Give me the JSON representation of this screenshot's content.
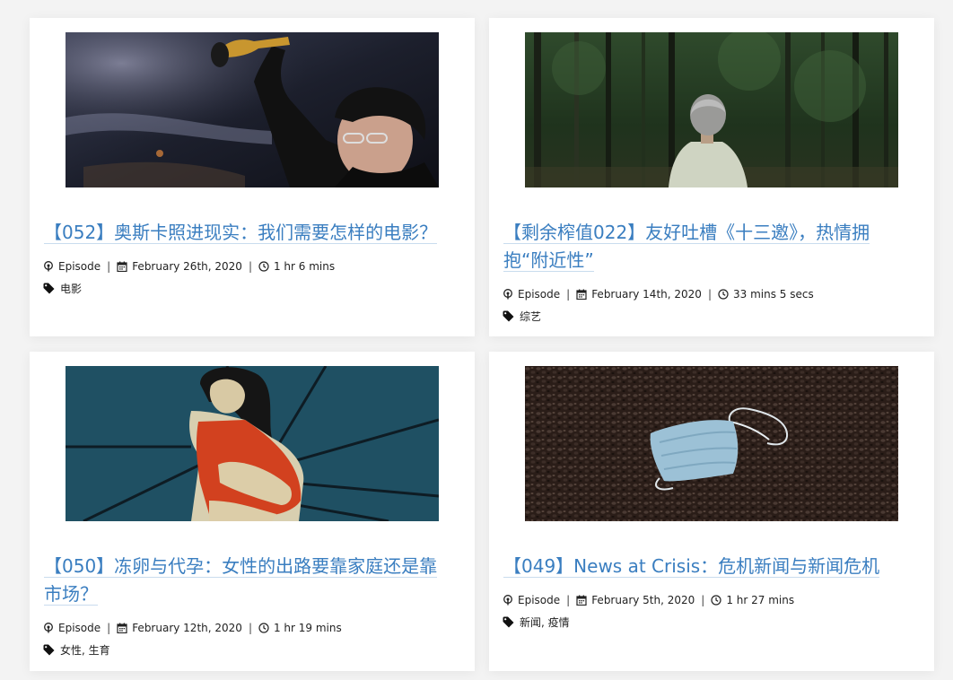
{
  "posts": [
    {
      "title": "【052】奥斯卡照进现实：我们需要怎样的电影？",
      "type": "Episode",
      "date": "February 26th, 2020",
      "duration": "1 hr 6 mins",
      "tags": "电影",
      "image": "oscar-winner-holding-statuette"
    },
    {
      "title": "【剩余榨值022】友好吐槽《十三邀》，热情拥抱“附近性”",
      "type": "Episode",
      "date": "February 14th, 2020",
      "duration": "33 mins 5 secs",
      "tags": "综艺",
      "image": "man-in-forest"
    },
    {
      "title": "【050】冻卵与代孕：女性的出路要靠家庭还是靠市场？",
      "type": "Episode",
      "date": "February 12th, 2020",
      "duration": "1 hr 19 mins",
      "tags": "女性, 生育",
      "image": "pregnant-woman-illustration"
    },
    {
      "title": "【049】News at Crisis：危机新闻与新闻危机",
      "type": "Episode",
      "date": "February 5th, 2020",
      "duration": "1 hr 27 mins",
      "tags": "新闻, 疫情",
      "image": "face-mask-on-ground"
    }
  ],
  "icons": {
    "type": "podcast-icon",
    "date": "calendar-icon",
    "duration": "clock-icon",
    "tags": "tag-icon"
  },
  "colors": {
    "title": "#3a7ec0",
    "background": "#f3f3f3",
    "card": "#ffffff"
  }
}
